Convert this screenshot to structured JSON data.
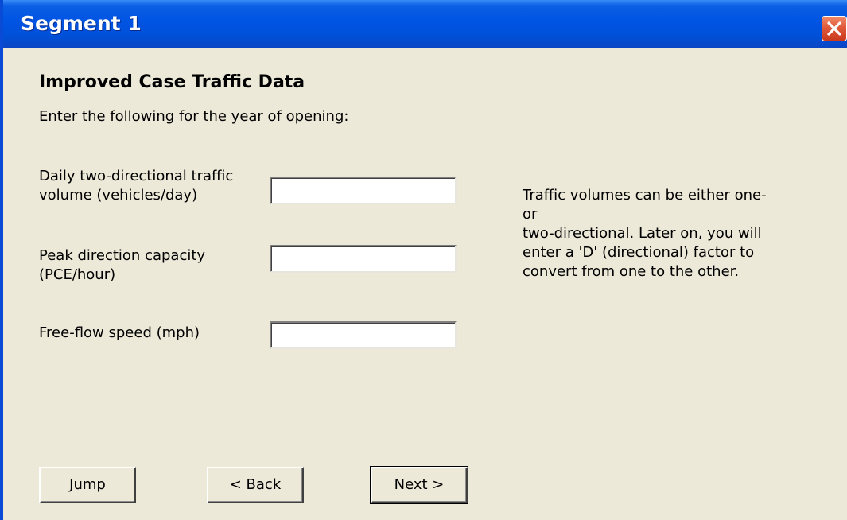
{
  "window": {
    "title": "Segment 1",
    "close_icon": "close-icon",
    "colors": {
      "titlebar": "#0054e3",
      "close": "#e05a3a",
      "background": "#ece9d8"
    }
  },
  "main": {
    "heading": "Improved Case Traffic Data",
    "instruction": "Enter the following for the year of opening:",
    "fields": [
      {
        "label_line1": "Daily two-directional traffic",
        "label_line2": "volume (vehicles/day)",
        "value": ""
      },
      {
        "label_line1": "Peak direction capacity",
        "label_line2": "(PCE/hour)",
        "value": ""
      },
      {
        "label_line1": "Free-flow speed (mph)",
        "label_line2": "",
        "value": ""
      }
    ],
    "note_lines": [
      "Traffic volumes can be either one- or",
      "two-directional. Later on, you will",
      "enter a 'D' (directional) factor to",
      "convert from one to the other."
    ]
  },
  "buttons": {
    "jump": "Jump",
    "back": "< Back",
    "next": "Next >"
  }
}
